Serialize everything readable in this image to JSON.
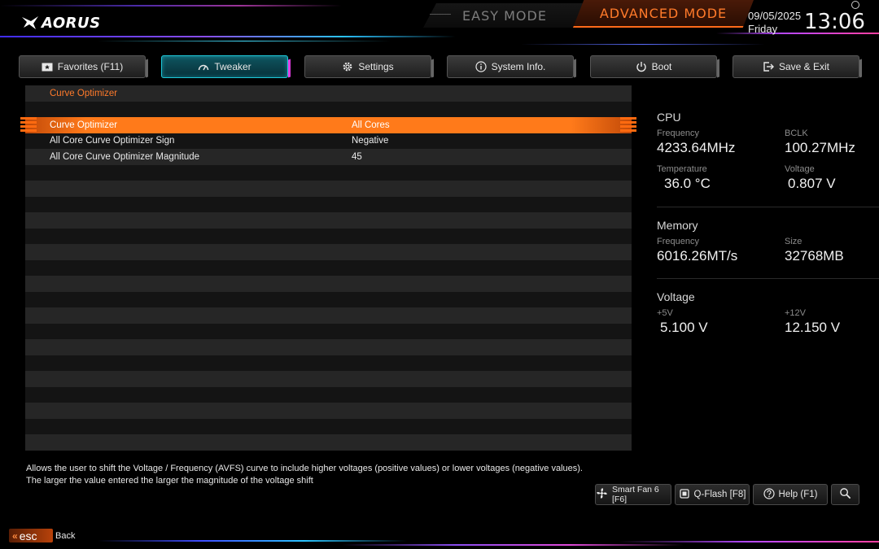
{
  "header": {
    "logo_text": "AORUS",
    "easy_mode": "EASY MODE",
    "advanced_mode": "ADVANCED MODE",
    "date": "09/05/2025",
    "day": "Friday",
    "time": "13:06"
  },
  "tabs": [
    {
      "label": "Favorites (F11)",
      "icon": "star-folder-icon"
    },
    {
      "label": "Tweaker",
      "icon": "gauge-icon"
    },
    {
      "label": "Settings",
      "icon": "gear-icon"
    },
    {
      "label": "System Info.",
      "icon": "info-icon"
    },
    {
      "label": "Boot",
      "icon": "power-icon"
    },
    {
      "label": "Save & Exit",
      "icon": "exit-icon"
    }
  ],
  "active_tab": "Tweaker",
  "main": {
    "section_title": "Curve Optimizer",
    "rows": [
      {
        "label": "Curve Optimizer",
        "value": "All Cores",
        "selected": true
      },
      {
        "label": "All Core Curve Optimizer Sign",
        "value": "Negative"
      },
      {
        "label": "All Core Curve Optimizer Magnitude",
        "value": "45"
      }
    ]
  },
  "side": {
    "cpu": {
      "title": "CPU",
      "frequency_label": "Frequency",
      "frequency": "4233.64MHz",
      "bclk_label": "BCLK",
      "bclk": "100.27MHz",
      "temperature_label": "Temperature",
      "temperature": "36.0 °C",
      "voltage_label": "Voltage",
      "voltage": "0.807 V"
    },
    "memory": {
      "title": "Memory",
      "frequency_label": "Frequency",
      "frequency": "6016.26MT/s",
      "size_label": "Size",
      "size": "32768MB"
    },
    "voltage": {
      "title": "Voltage",
      "v5_label": "+5V",
      "v5": "5.100 V",
      "v12_label": "+12V",
      "v12": "12.150 V"
    }
  },
  "help": {
    "line1": "Allows the user to shift the Voltage / Frequency (AVFS) curve to include higher voltages (positive values) or lower voltages (negative values).",
    "line2": "The larger the value entered the larger the magnitude of the voltage shift"
  },
  "footer": {
    "smart_fan": "Smart Fan 6 [F6]",
    "qflash": "Q-Flash [F8]",
    "help": "Help (F1)",
    "esc": "esc",
    "back": "Back"
  },
  "colors": {
    "accent": "#ff7a1a",
    "active_tab": "#1ec8d8"
  }
}
